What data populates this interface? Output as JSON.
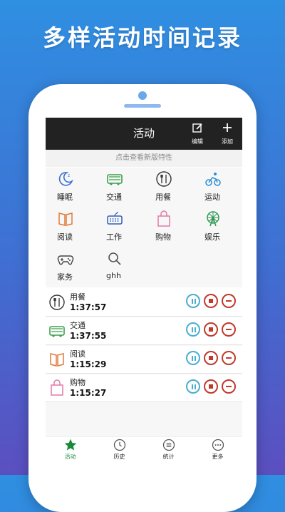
{
  "promo": {
    "headline": "多样活动时间记录"
  },
  "topbar": {
    "title": "活动",
    "edit_label": "编辑",
    "add_label": "添加"
  },
  "notice": "点击查看新版特性",
  "activities": [
    {
      "label": "睡眠",
      "icon": "moon-icon",
      "color": "#3b6fd6"
    },
    {
      "label": "交通",
      "icon": "bus-icon",
      "color": "#3aa04a"
    },
    {
      "label": "用餐",
      "icon": "cutlery-icon",
      "color": "#333333"
    },
    {
      "label": "运动",
      "icon": "cyclist-icon",
      "color": "#2a8fd6"
    },
    {
      "label": "阅读",
      "icon": "book-icon",
      "color": "#e07b39"
    },
    {
      "label": "工作",
      "icon": "keyboard-icon",
      "color": "#2f5fb8"
    },
    {
      "label": "购物",
      "icon": "shopping-bag-icon",
      "color": "#e07aa8"
    },
    {
      "label": "娱乐",
      "icon": "ferris-wheel-icon",
      "color": "#2e9a52"
    },
    {
      "label": "家务",
      "icon": "gamepad-icon",
      "color": "#444444"
    },
    {
      "label": "ghh",
      "icon": "search-icon",
      "color": "#555555"
    }
  ],
  "running": [
    {
      "name": "用餐",
      "time": "1:37:57",
      "icon": "cutlery-icon"
    },
    {
      "name": "交通",
      "time": "1:37:55",
      "icon": "bus-icon"
    },
    {
      "name": "阅读",
      "time": "1:15:29",
      "icon": "book-icon"
    },
    {
      "name": "购物",
      "time": "1:15:27",
      "icon": "shopping-bag-icon"
    }
  ],
  "nav": [
    {
      "label": "活动",
      "icon": "star-icon",
      "active": true
    },
    {
      "label": "历史",
      "icon": "clock-icon",
      "active": false
    },
    {
      "label": "统计",
      "icon": "list-icon",
      "active": false
    },
    {
      "label": "更多",
      "icon": "more-icon",
      "active": false
    }
  ],
  "colors": {
    "accent": "#1a8a3a",
    "pause": "#4aaed0",
    "stop": "#c0392b",
    "topbar": "#222222"
  }
}
